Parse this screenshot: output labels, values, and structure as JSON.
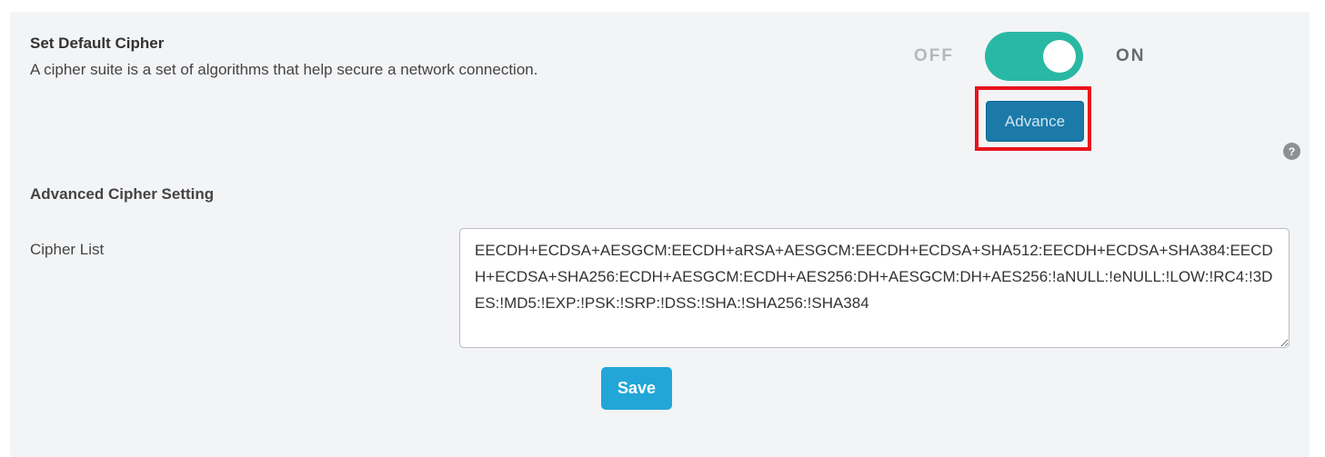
{
  "default_cipher": {
    "title": "Set Default Cipher",
    "description": "A cipher suite is a set of algorithms that help secure a network connection.",
    "toggle": {
      "off_label": "OFF",
      "on_label": "ON",
      "state": "on"
    },
    "advance_button_label": "Advance",
    "help_icon_glyph": "?"
  },
  "advanced": {
    "title": "Advanced Cipher Setting",
    "cipher_list_label": "Cipher List",
    "cipher_list_value": "EECDH+ECDSA+AESGCM:EECDH+aRSA+AESGCM:EECDH+ECDSA+SHA512:EECDH+ECDSA+SHA384:EECDH+ECDSA+SHA256:ECDH+AESGCM:ECDH+AES256:DH+AESGCM:DH+AES256:!aNULL:!eNULL:!LOW:!RC4:!3DES:!MD5:!EXP:!PSK:!SRP:!DSS:!SHA:!SHA256:!SHA384",
    "save_label": "Save"
  },
  "colors": {
    "panel_bg": "#f3f4f6",
    "toggle_on": "#29b8a3",
    "advance_button": "#1b7aa8",
    "save_button": "#22a6d8",
    "highlight": "#e8141c"
  },
  "icons": {
    "help": "help-icon"
  }
}
